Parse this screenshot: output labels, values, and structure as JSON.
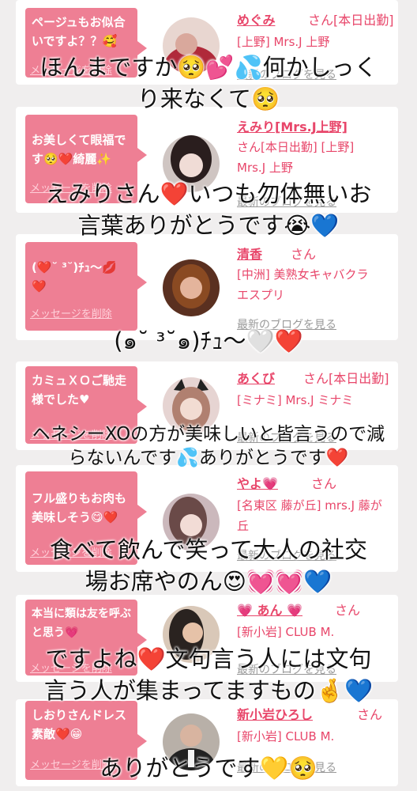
{
  "cards": [
    {
      "bubble": "ページュもお似合いですよ？？🥰",
      "delete": "メッセージを削除",
      "name": "めぐみ",
      "honorific": "さん[本日出勤]",
      "shop": "[上野] Mrs.J 上野",
      "blog": "最新のブログを見る",
      "avatar_color": "#b03040"
    },
    {
      "bubble": "お美しくて眼福です🥺❤️綺麗✨",
      "delete": "メッセージを削除",
      "name": "えみり[Mrs.J上野]",
      "honorific": "",
      "shop": "さん[本日出勤] [上野] Mrs.J 上野",
      "blog": "最新のブログを見る",
      "avatar_color": "#3a2a2a"
    },
    {
      "bubble": "(❤️˘ ³˘)ﾁｭ〜💋❤️",
      "delete": "メッセージを削除",
      "name": "清香",
      "honorific": "さん",
      "shop": "[中洲] 美熟女キャバクラ エスプリ",
      "blog": "最新のブログを見る",
      "avatar_color": "#8a4a2a"
    },
    {
      "bubble": "カミュＸＯご馳走様でした♥",
      "delete": "メッセージを削除",
      "name": "あくび",
      "honorific": "さん[本日出勤]",
      "shop": "[ミナミ] Mrs.J ミナミ",
      "blog": "最新のブログを見る",
      "avatar_color": "#c9a0a0"
    },
    {
      "bubble": "フル盛りもお肉も美味しそう😋❤️",
      "delete": "メッセージを削除",
      "name": "やよ💗",
      "honorific": "さん",
      "shop": "[名東区 藤が丘] mrs.J 藤が丘",
      "blog": "最新のブログを見る",
      "avatar_color": "#a07a80"
    },
    {
      "bubble": "本当に類は友を呼ぶと思う💗",
      "delete": "メッセージを削除",
      "name": "💗 あん 💗",
      "honorific": "さん",
      "shop": "[新小岩] CLUB M.",
      "blog": "最新のブログを見る",
      "avatar_color": "#2a2320"
    },
    {
      "bubble": "しおりさんドレス素敵❤️😁",
      "delete": "メッセージを削除",
      "name": "新小岩ひろし",
      "honorific": "さん",
      "shop": "[新小岩] CLUB M.",
      "blog": "最新のブログを見る",
      "avatar_color": "#3a3a3a"
    }
  ],
  "overlays": [
    "ほんまですか🥺💕💦何かしっく",
    "り来なくて🥺",
    "えみりさん❤️いつも勿体無いお",
    "言葉ありがとうです😭💙",
    "(๑˘ ³˘๑)ﾁｭ〜🤍❤️",
    "ヘネシーXOの方が美味しいと皆言うので減",
    "らないんです💦ありがとうです❤️",
    "食べて飲んで笑って大人の社交",
    "場お席やのん😍💓💓💙",
    "ですよね❤️文句言う人には文句",
    "言う人が集まってますもの🤞💙",
    "ありがとうです💛🥺"
  ],
  "colors": {
    "accent": "#e8466a",
    "bubble": "#ee7f94",
    "background": "#f0eeee"
  }
}
